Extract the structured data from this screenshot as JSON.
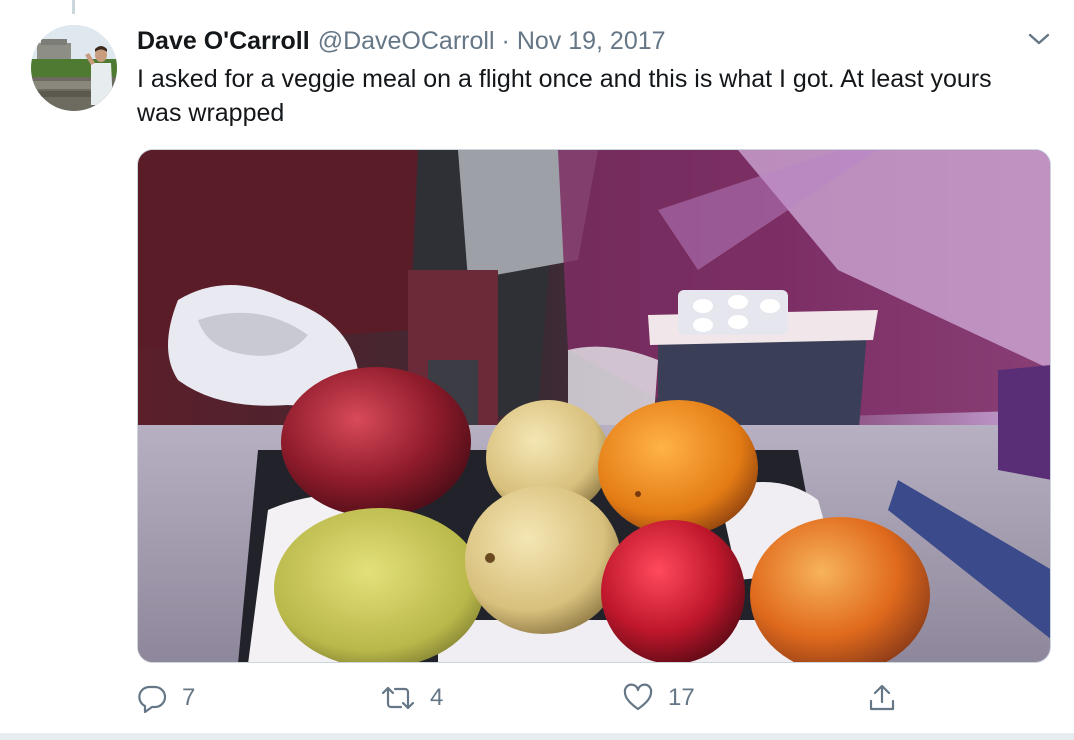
{
  "tweet": {
    "author": {
      "name": "Dave O'Carroll",
      "handle": "@DaveOCarroll",
      "avatar_icon": "profile-photo"
    },
    "separator": "·",
    "date": "Nov 19, 2017",
    "text": "I asked for a veggie meal on a flight once and this is what I got. At least yours was wrapped",
    "media": {
      "description_icon": "tray-of-fruit-photo"
    },
    "actions": {
      "reply": {
        "icon": "reply-icon",
        "count": "7"
      },
      "retweet": {
        "icon": "retweet-icon",
        "count": "4"
      },
      "like": {
        "icon": "heart-icon",
        "count": "17"
      },
      "share": {
        "icon": "share-icon"
      }
    }
  },
  "colors": {
    "text_primary": "#14171a",
    "text_secondary": "#657786",
    "border": "#ccd6dd",
    "background": "#ffffff"
  }
}
